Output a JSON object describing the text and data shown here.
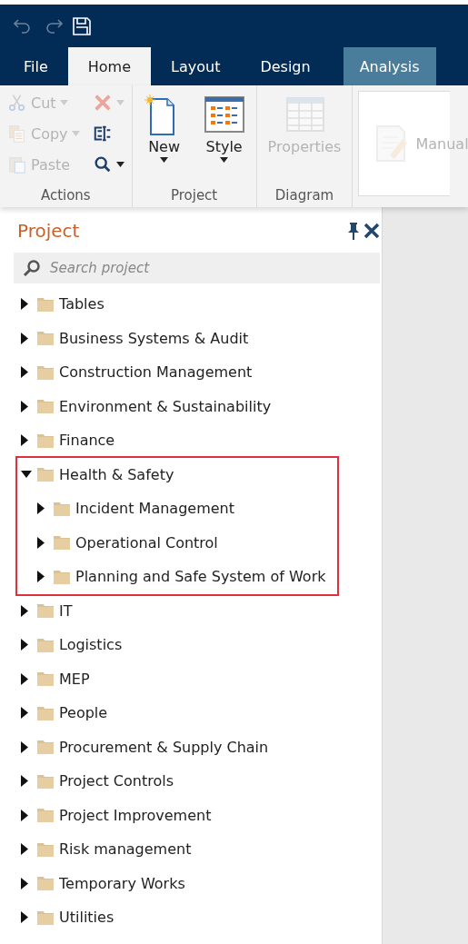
{
  "quick_access": [
    {
      "kind": "undo",
      "disabled": true
    },
    {
      "kind": "redo",
      "disabled": true
    },
    {
      "kind": "save",
      "disabled": false
    }
  ],
  "tabs": [
    {
      "label": "File",
      "selected": false,
      "kind": "plain"
    },
    {
      "label": "Home",
      "selected": true,
      "kind": "plain"
    },
    {
      "label": "Layout",
      "selected": false,
      "kind": "plain"
    },
    {
      "label": "Design",
      "selected": false,
      "kind": "plain"
    },
    {
      "label": "Analysis",
      "selected": false,
      "kind": "contextual"
    }
  ],
  "ribbon": {
    "groups": [
      {
        "label": "Actions",
        "kind": "small",
        "items": [
          {
            "kind": "cut",
            "label": "Cut",
            "disabled": true,
            "dropdown": true
          },
          {
            "kind": "copy",
            "label": "Copy",
            "disabled": true,
            "dropdown": true
          },
          {
            "kind": "paste",
            "label": "Paste",
            "disabled": true,
            "dropdown": false
          },
          {
            "kind": "delete",
            "disabled": true,
            "dropdown": true
          },
          {
            "kind": "rename",
            "disabled": false,
            "dropdown": false
          },
          {
            "kind": "find",
            "disabled": false,
            "dropdown": true
          }
        ]
      },
      {
        "label": "Project",
        "kind": "large",
        "items": [
          {
            "kind": "new",
            "label": "New",
            "disabled": false,
            "dropdown": true
          },
          {
            "kind": "style",
            "label": "Style",
            "disabled": false,
            "dropdown": true
          }
        ]
      },
      {
        "label": "Diagram",
        "kind": "large",
        "items": [
          {
            "kind": "properties",
            "label": "Properties",
            "disabled": true,
            "dropdown": false
          }
        ]
      },
      {
        "kind": "boxed",
        "items": [
          {
            "kind": "manual",
            "label": "Manual",
            "disabled": true,
            "dropdown": false
          }
        ]
      }
    ]
  },
  "panel": {
    "title": "Project",
    "search": {
      "placeholder": "Search project"
    },
    "tree": [
      {
        "label": "Tables",
        "expanded": false,
        "highlighted": false
      },
      {
        "label": "Business Systems & Audit",
        "expanded": false,
        "highlighted": false
      },
      {
        "label": "Construction Management",
        "expanded": false,
        "highlighted": false
      },
      {
        "label": "Environment & Sustainability",
        "expanded": false,
        "highlighted": false
      },
      {
        "label": "Finance",
        "expanded": false,
        "highlighted": false
      },
      {
        "label": "Health & Safety",
        "expanded": true,
        "highlighted": true,
        "children": [
          {
            "label": "Incident Management",
            "expanded": false
          },
          {
            "label": "Operational Control",
            "expanded": false
          },
          {
            "label": "Planning and Safe System of Work",
            "expanded": false
          }
        ]
      },
      {
        "label": "IT",
        "expanded": false,
        "highlighted": false
      },
      {
        "label": "Logistics",
        "expanded": false,
        "highlighted": false
      },
      {
        "label": "MEP",
        "expanded": false,
        "highlighted": false
      },
      {
        "label": "People",
        "expanded": false,
        "highlighted": false
      },
      {
        "label": "Procurement & Supply Chain",
        "expanded": false,
        "highlighted": false
      },
      {
        "label": "Project Controls",
        "expanded": false,
        "highlighted": false
      },
      {
        "label": "Project Improvement",
        "expanded": false,
        "highlighted": false
      },
      {
        "label": "Risk management",
        "expanded": false,
        "highlighted": false
      },
      {
        "label": "Temporary Works",
        "expanded": false,
        "highlighted": false
      },
      {
        "label": "Utilities",
        "expanded": false,
        "highlighted": false
      }
    ]
  }
}
